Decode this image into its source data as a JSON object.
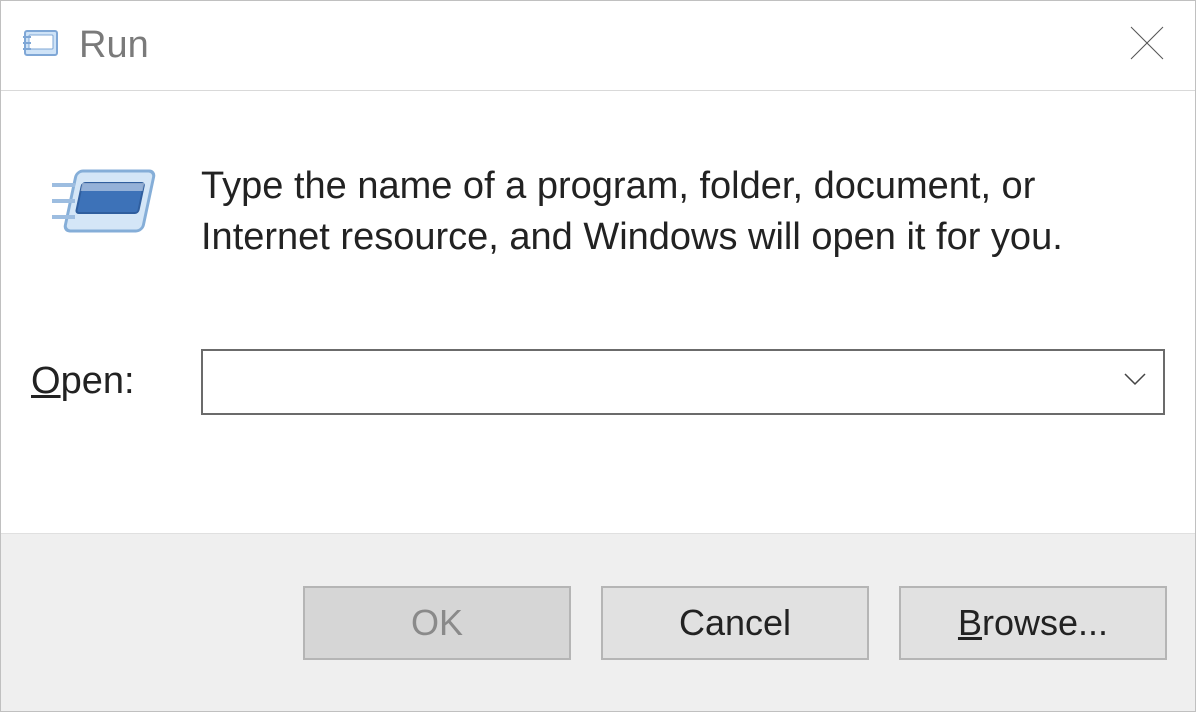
{
  "titlebar": {
    "title": "Run"
  },
  "body": {
    "description": "Type the name of a program, folder, document, or Internet resource, and Windows will open it for you.",
    "open_label_prefix": "O",
    "open_label_rest": "pen:",
    "open_value": ""
  },
  "footer": {
    "ok_label": "OK",
    "cancel_label": "Cancel",
    "browse_prefix": "B",
    "browse_rest": "rowse..."
  }
}
